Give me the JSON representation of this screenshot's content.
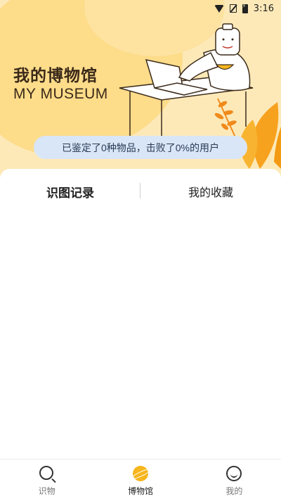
{
  "status_bar": {
    "time": "3:16",
    "icons": [
      "wifi-icon",
      "no-sim-icon",
      "battery-charging-icon"
    ]
  },
  "header": {
    "title_cn": "我的博物馆",
    "title_en": "MY MUSEUM",
    "illustration": "person-at-laptop-illustration"
  },
  "stats": {
    "text": "已鉴定了0种物品，击败了0%的用户"
  },
  "tabs": [
    {
      "label": "识图记录",
      "active": true
    },
    {
      "label": "我的收藏",
      "active": false
    }
  ],
  "bottom_nav": [
    {
      "label": "识物",
      "icon": "search-icon",
      "active": false
    },
    {
      "label": "博物馆",
      "icon": "planet-icon",
      "active": true
    },
    {
      "label": "我的",
      "icon": "profile-face-icon",
      "active": false
    }
  ],
  "colors": {
    "accent": "#f7b51e",
    "hero_bg": "#fde9b8",
    "pill_bg": "#d9e6f7"
  }
}
